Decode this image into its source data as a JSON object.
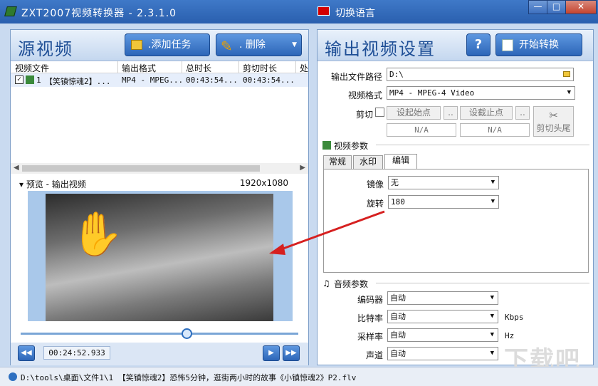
{
  "window": {
    "title": "ZXT2007视频转换器 - 2.3.1.0",
    "language_label": "切换语言",
    "minimize": "—",
    "maximize": "□",
    "close": "✕"
  },
  "left_panel": {
    "title": "源视频",
    "add_task_label": ".添加任务",
    "delete_label": ".   删除",
    "table": {
      "columns": [
        "视频文件",
        "输出格式",
        "总时长",
        "剪切时长",
        "处"
      ],
      "rows": [
        {
          "index": "1",
          "file": "【笑镇惊魂2】...",
          "format": "MP4 - MPEG...",
          "duration": "00:43:54...",
          "cut_duration": "00:43:54...",
          "checked": "✓"
        }
      ]
    },
    "preview_label": "▾ 预览 - 输出视频",
    "resolution": "1920x1080",
    "current_time": "00:24:52.933",
    "progress_fraction": 0.6
  },
  "right_panel": {
    "title": "输出视频设置",
    "help_label": "?",
    "start_label": "开始转换",
    "output_path_label": "输出文件路径",
    "output_path_value": "D:\\",
    "format_label": "视频格式",
    "format_value": "MP4 - MPEG-4 Video",
    "cut_label": "剪切",
    "set_start_label": "设起始点",
    "set_end_label": "设截止点",
    "more_label": "..",
    "start_value": "N/A",
    "end_value": "N/A",
    "cut_head_label": "剪切头尾",
    "video_params_title": "视频参数",
    "tabs": [
      "常规",
      "水印",
      "编辑"
    ],
    "mirror_label": "镜像",
    "mirror_value": "无",
    "rotate_label": "旋转",
    "rotate_value": "180",
    "audio_params_title": "音频参数",
    "encoder_label": "编码器",
    "encoder_value": "自动",
    "bitrate_label": "比特率",
    "bitrate_value": "自动",
    "bitrate_unit": "Kbps",
    "samplerate_label": "采样率",
    "samplerate_value": "自动",
    "samplerate_unit": "Hz",
    "channel_label": "声道",
    "channel_value": "自动"
  },
  "status_bar": {
    "text": "D:\\tools\\桌面\\文件1\\1 【笑镇惊魂2】恐怖5分钟，逛街两小时的故事《小镇惊魂2》P2.flv"
  },
  "watermark": "下载吧",
  "colors": {
    "title_bar": "#2f66b5",
    "accent_blue": "#2d66b8",
    "panel_bg": "#c9daf0",
    "annotation_arrow": "#d62020"
  }
}
